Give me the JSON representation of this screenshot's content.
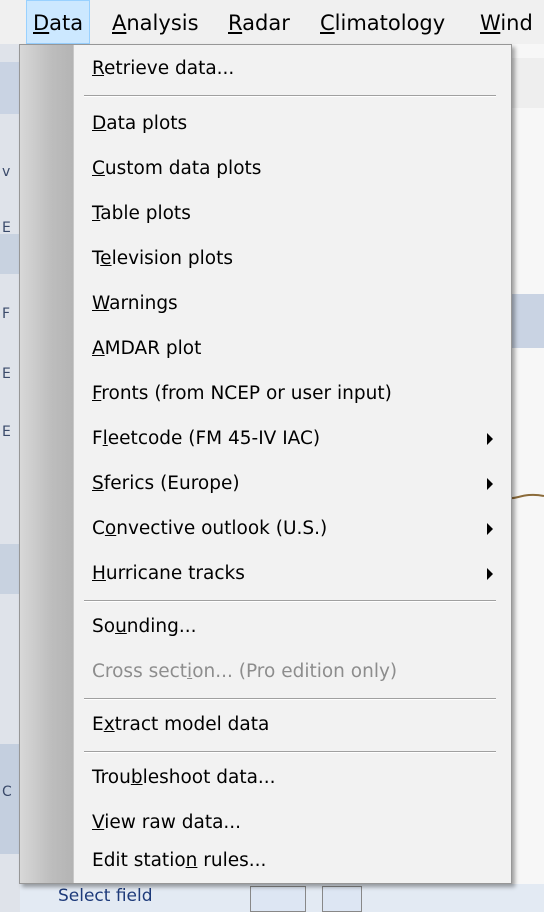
{
  "menubar": {
    "items": [
      {
        "label": "Data",
        "mnemonic": "D",
        "rest": "ata"
      },
      {
        "label": "Analysis",
        "mnemonic": "A",
        "rest": "nalysis"
      },
      {
        "label": "Radar",
        "mnemonic": "R",
        "rest": "adar"
      },
      {
        "label": "Climatology",
        "mnemonic": "C",
        "rest": "limatology"
      },
      {
        "label": "Window",
        "mnemonic": "W",
        "rest": "ind"
      }
    ]
  },
  "menu": {
    "items": [
      {
        "pre": "",
        "u": "R",
        "post": "etrieve data...",
        "submenu": false,
        "disabled": false
      },
      {
        "pre": "",
        "u": "D",
        "post": "ata plots",
        "submenu": false,
        "disabled": false
      },
      {
        "pre": "",
        "u": "C",
        "post": "ustom data plots",
        "submenu": false,
        "disabled": false
      },
      {
        "pre": "",
        "u": "T",
        "post": "able plots",
        "submenu": false,
        "disabled": false
      },
      {
        "pre": "T",
        "u": "e",
        "post": "levision plots",
        "submenu": false,
        "disabled": false
      },
      {
        "pre": "",
        "u": "W",
        "post": "arnings",
        "submenu": false,
        "disabled": false
      },
      {
        "pre": "",
        "u": "A",
        "post": "MDAR plot",
        "submenu": false,
        "disabled": false
      },
      {
        "pre": "",
        "u": "F",
        "post": "ronts (from NCEP or user input)",
        "submenu": false,
        "disabled": false
      },
      {
        "pre": "F",
        "u": "l",
        "post": "eetcode (FM 45-IV IAC)",
        "submenu": true,
        "disabled": false
      },
      {
        "pre": "",
        "u": "S",
        "post": "ferics (Europe)",
        "submenu": true,
        "disabled": false
      },
      {
        "pre": "C",
        "u": "o",
        "post": "nvective outlook (U.S.)",
        "submenu": true,
        "disabled": false
      },
      {
        "pre": "",
        "u": "H",
        "post": "urricane tracks",
        "submenu": true,
        "disabled": false
      },
      {
        "pre": "So",
        "u": "u",
        "post": "nding...",
        "submenu": false,
        "disabled": false
      },
      {
        "pre": "Cross sect",
        "u": "i",
        "post": "on... (Pro edition only)",
        "submenu": false,
        "disabled": true
      },
      {
        "pre": "E",
        "u": "x",
        "post": "tract model data",
        "submenu": false,
        "disabled": false
      },
      {
        "pre": "Trou",
        "u": "b",
        "post": "leshoot data...",
        "submenu": false,
        "disabled": false
      },
      {
        "pre": "",
        "u": "V",
        "post": "iew raw data...",
        "submenu": false,
        "disabled": false
      },
      {
        "pre": "Edit statio",
        "u": "n",
        "post": " rules...",
        "submenu": false,
        "disabled": false
      }
    ]
  },
  "background": {
    "bottom_field_label": "Select field"
  },
  "colors": {
    "active_menu": "#cce8ff",
    "disabled_text": "#8d8d8d"
  }
}
